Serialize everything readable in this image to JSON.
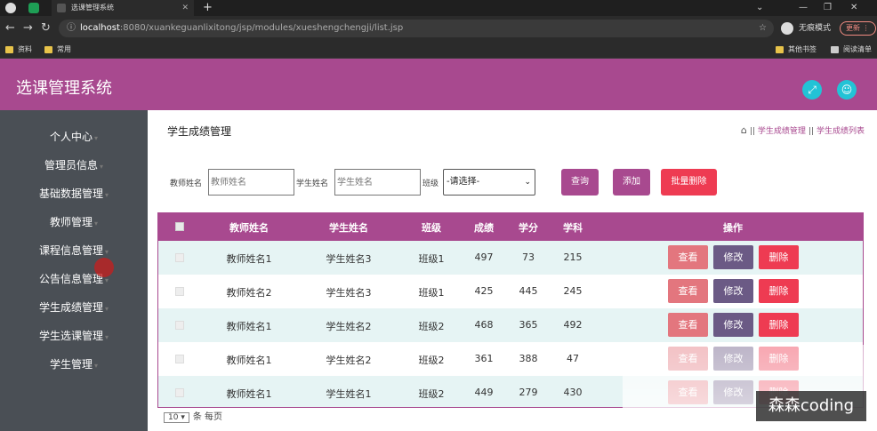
{
  "browser": {
    "tab_title": "选课管理系统",
    "url_host": "localhost",
    "url_rest": ":8080/xuankeguanlixitong/jsp/modules/xueshengchengji/list.jsp",
    "profile_label": "无痕模式",
    "update_label": "更新",
    "bookmarks": [
      "资料",
      "常用"
    ],
    "bookmarks_right": [
      "其他书签",
      "阅读清单"
    ]
  },
  "app": {
    "title": "选课管理系统",
    "header_icons": [
      "fullscreen-icon",
      "user-icon"
    ]
  },
  "sidebar": {
    "items": [
      {
        "label": "个人中心"
      },
      {
        "label": "管理员信息"
      },
      {
        "label": "基础数据管理"
      },
      {
        "label": "教师管理"
      },
      {
        "label": "课程信息管理"
      },
      {
        "label": "公告信息管理"
      },
      {
        "label": "学生成绩管理"
      },
      {
        "label": "学生选课管理"
      },
      {
        "label": "学生管理"
      }
    ]
  },
  "page": {
    "title": "学生成绩管理",
    "breadcrumb": [
      "学生成绩管理",
      "学生成绩列表"
    ]
  },
  "filters": {
    "teacher_label": "教师姓名",
    "teacher_placeholder": "教师姓名",
    "student_label": "学生姓名",
    "student_placeholder": "学生姓名",
    "class_label": "班级",
    "class_selected": "-请选择-",
    "search_button": "查询",
    "add_button": "添加",
    "batch_delete_button": "批量删除"
  },
  "table": {
    "headers": [
      "教师姓名",
      "学生姓名",
      "班级",
      "成绩",
      "学分",
      "学科",
      "操作"
    ],
    "rows": [
      {
        "teacher": "教师姓名1",
        "student": "学生姓名3",
        "class": "班级1",
        "score": "497",
        "credit": "73",
        "subject": "215"
      },
      {
        "teacher": "教师姓名2",
        "student": "学生姓名3",
        "class": "班级1",
        "score": "425",
        "credit": "445",
        "subject": "245"
      },
      {
        "teacher": "教师姓名1",
        "student": "学生姓名2",
        "class": "班级2",
        "score": "468",
        "credit": "365",
        "subject": "492"
      },
      {
        "teacher": "教师姓名1",
        "student": "学生姓名2",
        "class": "班级2",
        "score": "361",
        "credit": "388",
        "subject": "47"
      },
      {
        "teacher": "教师姓名1",
        "student": "学生姓名1",
        "class": "班级2",
        "score": "449",
        "credit": "279",
        "subject": "430"
      }
    ],
    "actions": {
      "view": "查看",
      "edit": "修改",
      "delete": "删除"
    }
  },
  "pager": {
    "page_size": "10",
    "per_page_label": "条 每页"
  },
  "watermark": "森森coding",
  "colors": {
    "primary": "#a8498f",
    "view_btn": "#e3767e",
    "edit_btn": "#6b5a85",
    "delete_btn": "#ee3b52",
    "accent_icon": "#22c3d6",
    "sidebar_bg": "#4a4f55"
  }
}
